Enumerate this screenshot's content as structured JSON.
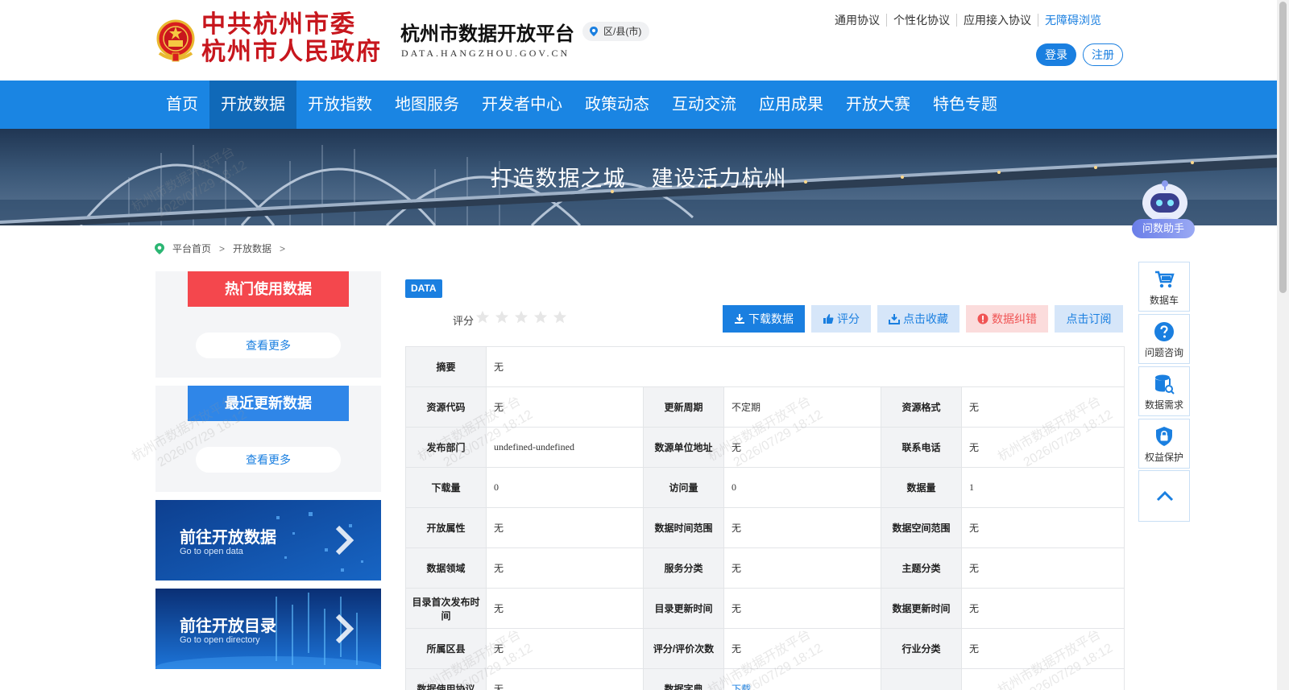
{
  "header": {
    "gov_line1": "中共杭州市委",
    "gov_line2": "杭州市人民政府",
    "site_title": "杭州市数据开放平台",
    "site_sub": "DATA.HANGZHOU.GOV.CN",
    "region": "区/县(市)",
    "top_links": [
      "通用协议",
      "个性化协议",
      "应用接入协议",
      "无障碍浏览"
    ],
    "login": "登录",
    "register": "注册"
  },
  "nav": {
    "items": [
      "首页",
      "开放数据",
      "开放指数",
      "地图服务",
      "开发者中心",
      "政策动态",
      "互动交流",
      "应用成果",
      "开放大赛",
      "特色专题"
    ],
    "active_index": 1
  },
  "banner": {
    "slogan_left": "打造数据之城",
    "slogan_right": "建设活力杭州"
  },
  "assistant": {
    "label": "问数助手"
  },
  "breadcrumb": {
    "home": "平台首页",
    "current": "开放数据",
    "sep": ">"
  },
  "sidebar": {
    "hot": {
      "title": "热门使用数据",
      "more": "查看更多"
    },
    "recent": {
      "title": "最近更新数据",
      "more": "查看更多"
    },
    "promo_open_data": {
      "title": "前往开放数据",
      "sub": "Go to open data"
    },
    "promo_open_dir": {
      "title": "前往开放目录",
      "sub": "Go to open directory"
    }
  },
  "main": {
    "tag": "DATA",
    "rating_label": "评分",
    "rating_value": 0,
    "rating_max": 5,
    "actions": {
      "download": "下载数据",
      "rate": "评分",
      "favorite": "点击收藏",
      "report": "数据纠错",
      "subscribe": "点击订阅"
    },
    "summary": {
      "label": "摘要",
      "value": "无"
    },
    "rows": [
      [
        [
          "资源代码",
          "无"
        ],
        [
          "更新周期",
          "不定期"
        ],
        [
          "资源格式",
          "无"
        ]
      ],
      [
        [
          "发布部门",
          "undefined-undefined"
        ],
        [
          "数源单位地址",
          "无"
        ],
        [
          "联系电话",
          "无"
        ]
      ],
      [
        [
          "下载量",
          "0"
        ],
        [
          "访问量",
          "0"
        ],
        [
          "数据量",
          "1"
        ]
      ],
      [
        [
          "开放属性",
          "无"
        ],
        [
          "数据时间范围",
          "无"
        ],
        [
          "数据空间范围",
          "无"
        ]
      ],
      [
        [
          "数据领域",
          "无"
        ],
        [
          "服务分类",
          "无"
        ],
        [
          "主题分类",
          "无"
        ]
      ],
      [
        [
          "目录首次发布时间",
          "无"
        ],
        [
          "目录更新时间",
          "无"
        ],
        [
          "数据更新时间",
          "无"
        ]
      ],
      [
        [
          "所属区县",
          "无"
        ],
        [
          "评分/评价次数",
          "无"
        ],
        [
          "行业分类",
          "无"
        ]
      ],
      [
        [
          "数据使用协议",
          "无"
        ],
        [
          "数据字典",
          "下载"
        ],
        [
          "",
          ""
        ]
      ]
    ]
  },
  "side_tools": [
    "数据车",
    "问题咨询",
    "数据需求",
    "权益保护"
  ],
  "watermark": {
    "line1": "杭州市数据开放平台",
    "line2": "2026/07/29 18:12"
  },
  "colors": {
    "brand_blue": "#1a85e3",
    "nav_active": "#1069b8",
    "gov_red": "#c7161d",
    "hot_red": "#f4474d"
  }
}
